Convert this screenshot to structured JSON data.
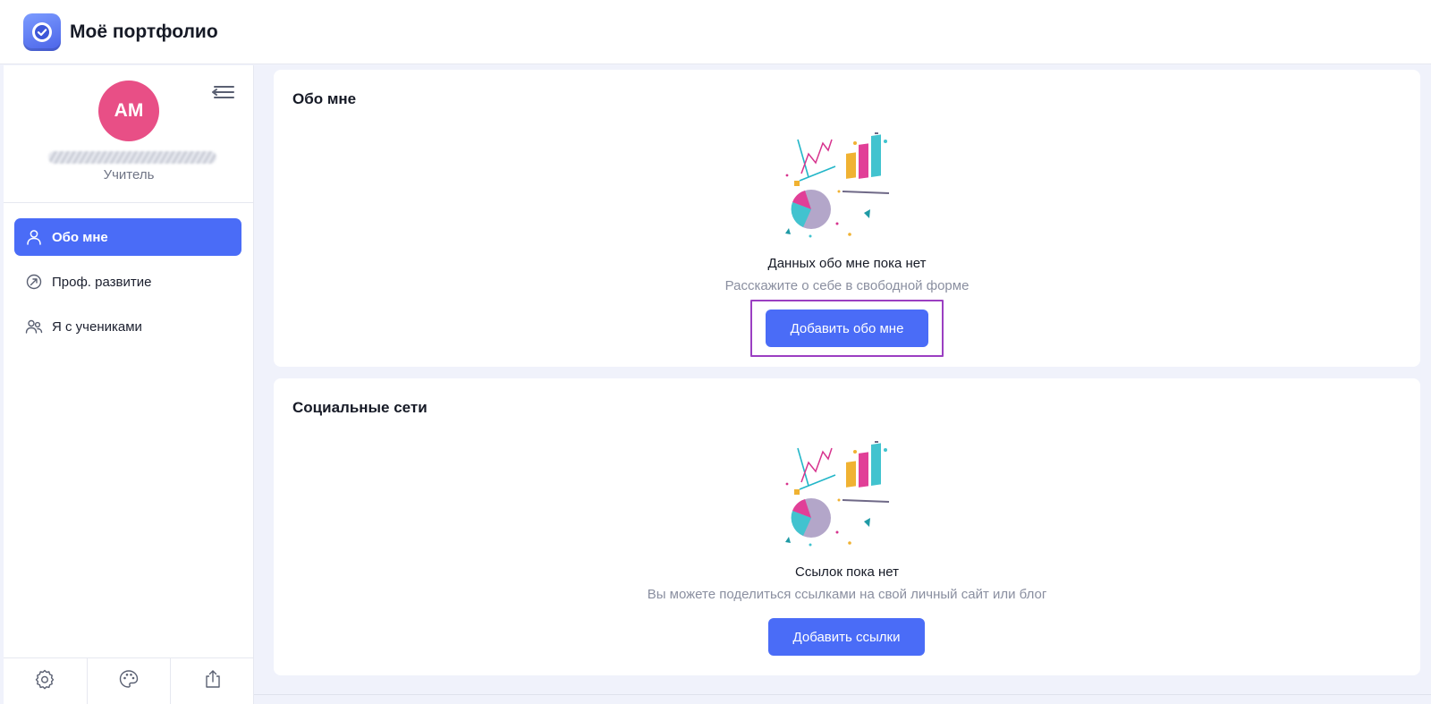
{
  "header": {
    "app_title": "Моё портфолио",
    "logo_icon": "check-badge-icon"
  },
  "sidebar": {
    "avatar_initials": "АМ",
    "user_role": "Учитель",
    "collapse_icon": "collapse-menu-icon",
    "nav": [
      {
        "label": "Обо мне",
        "icon": "user-icon",
        "active": true
      },
      {
        "label": "Проф. развитие",
        "icon": "growth-arrow-icon",
        "active": false
      },
      {
        "label": "Я с учениками",
        "icon": "users-icon",
        "active": false
      }
    ],
    "footer": [
      {
        "icon": "gear-icon"
      },
      {
        "icon": "palette-icon"
      },
      {
        "icon": "share-icon"
      }
    ]
  },
  "main": {
    "about": {
      "title": "Обо мне",
      "empty_title": "Данных обо мне пока нет",
      "empty_sub": "Расскажите о себе в свободной форме",
      "button": "Добавить обо мне",
      "highlighted": true
    },
    "social": {
      "title": "Социальные сети",
      "empty_title": "Ссылок пока нет",
      "empty_sub": "Вы можете поделиться ссылками на свой личный сайт или блог",
      "button": "Добавить ссылки"
    }
  },
  "colors": {
    "accent": "#4a6cf7",
    "avatar": "#e84f86",
    "highlight": "#9b3fc2",
    "background": "#f0f2fb"
  }
}
